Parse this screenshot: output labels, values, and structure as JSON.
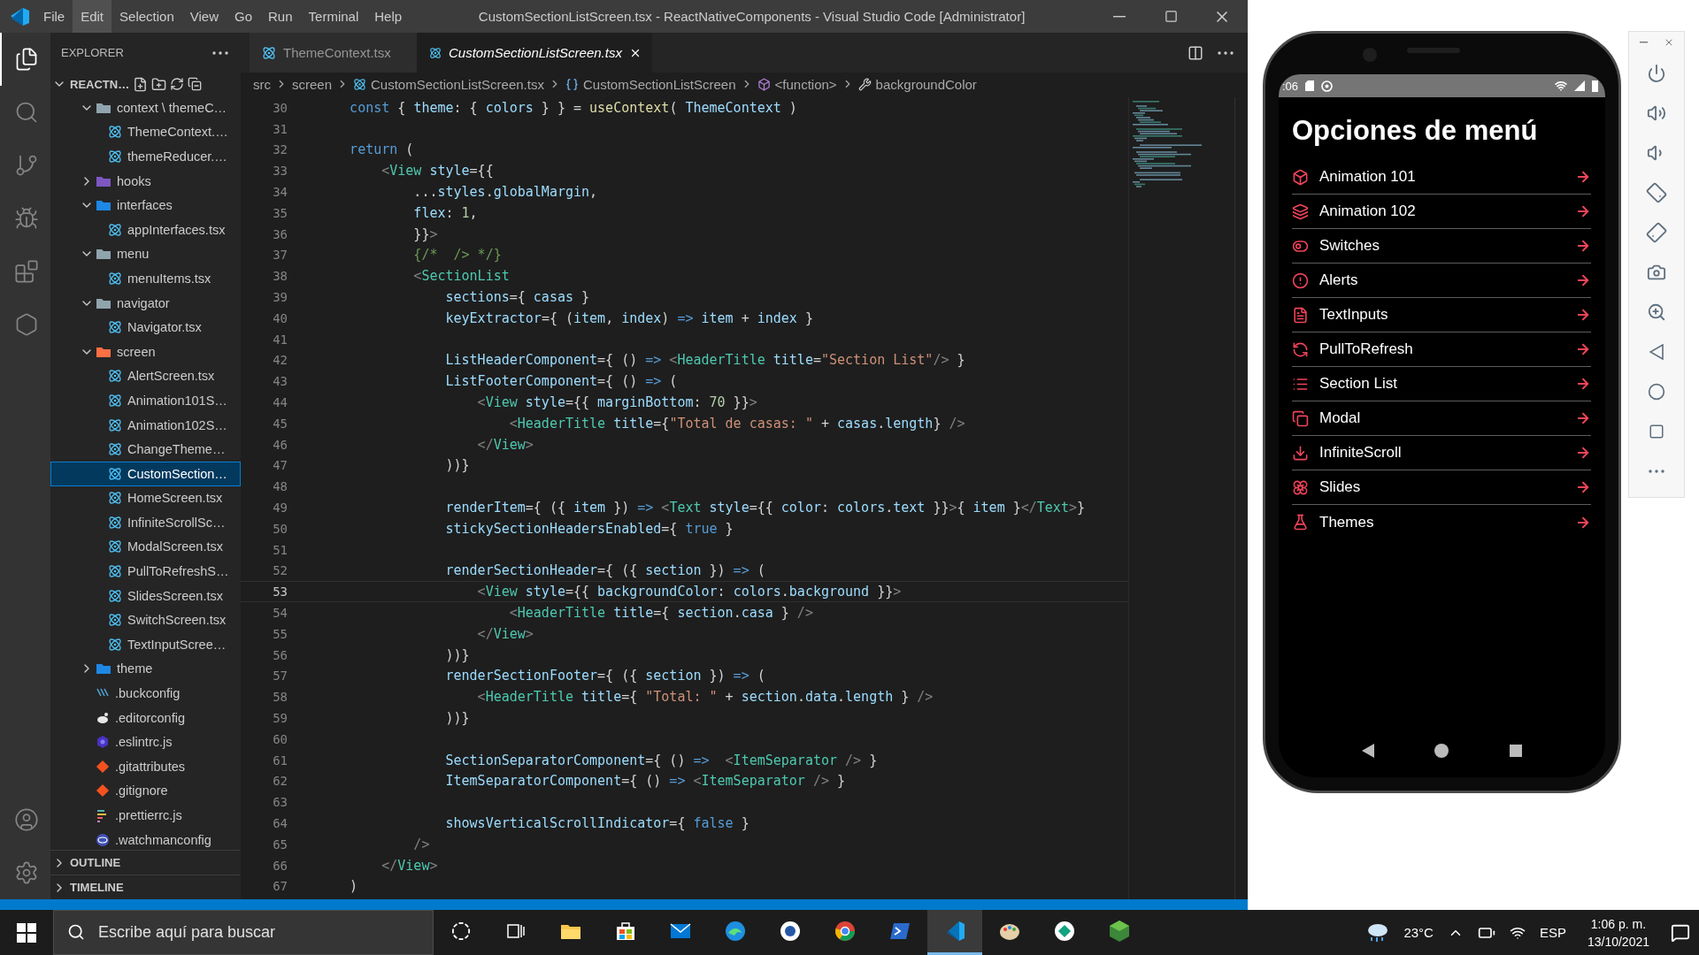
{
  "window": {
    "title": "CustomSectionListScreen.tsx - ReactNativeComponents - Visual Studio Code [Administrator]",
    "menu": [
      {
        "label": "File",
        "selected": false
      },
      {
        "label": "Edit",
        "selected": true
      },
      {
        "label": "Selection",
        "selected": false
      },
      {
        "label": "View",
        "selected": false
      },
      {
        "label": "Go",
        "selected": false
      },
      {
        "label": "Run",
        "selected": false
      },
      {
        "label": "Terminal",
        "selected": false
      },
      {
        "label": "Help",
        "selected": false
      }
    ]
  },
  "activity_bar": [
    {
      "selected": true
    },
    {
      "selected": false
    },
    {
      "selected": false
    },
    {
      "selected": false
    },
    {
      "selected": false
    },
    {
      "selected": false
    }
  ],
  "explorer": {
    "title": "EXPLORER",
    "root": {
      "label": "REACTN…",
      "expanded": true
    },
    "items": [
      {
        "label": "context \\ themeC…",
        "kind": "folder",
        "color": "#90a4ae",
        "expanded": true,
        "selected": false,
        "children": [
          {
            "label": "ThemeContext.…",
            "kind": "react",
            "selected": false
          },
          {
            "label": "themeReducer.…",
            "kind": "react",
            "selected": false
          }
        ]
      },
      {
        "label": "hooks",
        "kind": "folder",
        "color": "#7e57c2",
        "expanded": false,
        "selected": false
      },
      {
        "label": "interfaces",
        "kind": "folder",
        "color": "#1e88e5",
        "expanded": true,
        "selected": false,
        "children": [
          {
            "label": "appInterfaces.tsx",
            "kind": "react",
            "selected": false
          }
        ]
      },
      {
        "label": "menu",
        "kind": "folder",
        "color": "#90a4ae",
        "expanded": true,
        "selected": false,
        "children": [
          {
            "label": "menuItems.tsx",
            "kind": "react",
            "selected": false
          }
        ]
      },
      {
        "label": "navigator",
        "kind": "folder",
        "color": "#90a4ae",
        "expanded": true,
        "selected": false,
        "children": [
          {
            "label": "Navigator.tsx",
            "kind": "react",
            "selected": false
          }
        ]
      },
      {
        "label": "screen",
        "kind": "folder",
        "color": "#ff7043",
        "expanded": true,
        "selected": false,
        "children": [
          {
            "label": "AlertScreen.tsx",
            "kind": "react",
            "selected": false
          },
          {
            "label": "Animation101S…",
            "kind": "react",
            "selected": false
          },
          {
            "label": "Animation102S…",
            "kind": "react",
            "selected": false
          },
          {
            "label": "ChangeTheme…",
            "kind": "react",
            "selected": false
          },
          {
            "label": "CustomSection…",
            "kind": "react",
            "selected": true
          },
          {
            "label": "HomeScreen.tsx",
            "kind": "react",
            "selected": false
          },
          {
            "label": "InfiniteScrollSc…",
            "kind": "react",
            "selected": false
          },
          {
            "label": "ModalScreen.tsx",
            "kind": "react",
            "selected": false
          },
          {
            "label": "PullToRefreshS…",
            "kind": "react",
            "selected": false
          },
          {
            "label": "SlidesScreen.tsx",
            "kind": "react",
            "selected": false
          },
          {
            "label": "SwitchScreen.tsx",
            "kind": "react",
            "selected": false
          },
          {
            "label": "TextInputScree…",
            "kind": "react",
            "selected": false
          }
        ]
      },
      {
        "label": "theme",
        "kind": "folder",
        "color": "#1e88e5",
        "expanded": false,
        "selected": false
      },
      {
        "label": ".buckconfig",
        "kind": "buck",
        "selected": false
      },
      {
        "label": ".editorconfig",
        "kind": "editor",
        "selected": false
      },
      {
        "label": ".eslintrc.js",
        "kind": "eslint",
        "selected": false
      },
      {
        "label": ".gitattributes",
        "kind": "git",
        "selected": false
      },
      {
        "label": ".gitignore",
        "kind": "git",
        "selected": false
      },
      {
        "label": ".prettierrc.js",
        "kind": "prettier",
        "selected": false
      },
      {
        "label": ".watchmanconfig",
        "kind": "watchman",
        "selected": false
      }
    ],
    "sections": [
      {
        "label": "OUTLINE",
        "expanded": false
      },
      {
        "label": "TIMELINE",
        "expanded": false
      }
    ]
  },
  "tabs": [
    {
      "label": "ThemeContext.tsx",
      "selected": false
    },
    {
      "label": "CustomSectionListScreen.tsx",
      "selected": true
    }
  ],
  "breadcrumbs": [
    {
      "label": "src",
      "kind": "folder"
    },
    {
      "label": "screen",
      "kind": "folder"
    },
    {
      "label": "CustomSectionListScreen.tsx",
      "kind": "file"
    },
    {
      "label": "CustomSectionListScreen",
      "kind": "component"
    },
    {
      "label": "<function>",
      "kind": "function"
    },
    {
      "label": "backgroundColor",
      "kind": "property"
    }
  ],
  "editor": {
    "lines": [
      {
        "number": "30",
        "current": false,
        "tokens": [
          {
            "kind": "k",
            "text": "    const"
          },
          {
            "kind": "p",
            "text": " { "
          },
          {
            "kind": "v",
            "text": "theme"
          },
          {
            "kind": "p",
            "text": ": { "
          },
          {
            "kind": "v",
            "text": "colors"
          },
          {
            "kind": "p",
            "text": " } } = "
          },
          {
            "kind": "f",
            "text": "useContext"
          },
          {
            "kind": "p",
            "text": "( "
          },
          {
            "kind": "v",
            "text": "ThemeContext"
          },
          {
            "kind": "p",
            "text": " )"
          }
        ]
      },
      {
        "number": "31",
        "current": false
      },
      {
        "number": "32",
        "current": false,
        "tokens": [
          {
            "kind": "k",
            "text": "    return"
          },
          {
            "kind": "p",
            "text": " ("
          }
        ]
      },
      {
        "number": "33",
        "current": false,
        "tokens": [
          {
            "kind": "g",
            "text": "        <"
          },
          {
            "kind": "c",
            "text": "View"
          },
          {
            "kind": "v",
            "text": " style"
          },
          {
            "kind": "p",
            "text": "={{"
          }
        ]
      },
      {
        "number": "34",
        "current": false,
        "tokens": [
          {
            "kind": "p",
            "text": "            ..."
          },
          {
            "kind": "v",
            "text": "styles"
          },
          {
            "kind": "p",
            "text": "."
          },
          {
            "kind": "v",
            "text": "globalMargin"
          },
          {
            "kind": "p",
            "text": ","
          }
        ]
      },
      {
        "number": "35",
        "current": false,
        "tokens": [
          {
            "kind": "v",
            "text": "            flex"
          },
          {
            "kind": "p",
            "text": ": "
          },
          {
            "kind": "n",
            "text": "1"
          },
          {
            "kind": "p",
            "text": ","
          }
        ]
      },
      {
        "number": "36",
        "current": false,
        "tokens": [
          {
            "kind": "p",
            "text": "            }}"
          },
          {
            "kind": "g",
            "text": ">"
          }
        ]
      },
      {
        "number": "37",
        "current": false,
        "tokens": [
          {
            "kind": "m",
            "text": "            {/*  /> */}"
          }
        ]
      },
      {
        "number": "38",
        "current": false,
        "tokens": [
          {
            "kind": "g",
            "text": "            <"
          },
          {
            "kind": "c",
            "text": "SectionList"
          }
        ]
      },
      {
        "number": "39",
        "current": false,
        "tokens": [
          {
            "kind": "v",
            "text": "                sections"
          },
          {
            "kind": "p",
            "text": "={ "
          },
          {
            "kind": "v",
            "text": "casas"
          },
          {
            "kind": "p",
            "text": " }"
          }
        ]
      },
      {
        "number": "40",
        "current": false,
        "tokens": [
          {
            "kind": "v",
            "text": "                keyExtractor"
          },
          {
            "kind": "p",
            "text": "={ ("
          },
          {
            "kind": "v",
            "text": "item"
          },
          {
            "kind": "p",
            "text": ", "
          },
          {
            "kind": "v",
            "text": "index"
          },
          {
            "kind": "p",
            "text": ") "
          },
          {
            "kind": "k",
            "text": "=>"
          },
          {
            "kind": "v",
            "text": " item"
          },
          {
            "kind": "p",
            "text": " + "
          },
          {
            "kind": "v",
            "text": "index"
          },
          {
            "kind": "p",
            "text": " }"
          }
        ]
      },
      {
        "number": "41",
        "current": false
      },
      {
        "number": "42",
        "current": false,
        "tokens": [
          {
            "kind": "v",
            "text": "                ListHeaderComponent"
          },
          {
            "kind": "p",
            "text": "={ () "
          },
          {
            "kind": "k",
            "text": "=>"
          },
          {
            "kind": "g",
            "text": " <"
          },
          {
            "kind": "c",
            "text": "HeaderTitle"
          },
          {
            "kind": "v",
            "text": " title"
          },
          {
            "kind": "p",
            "text": "="
          },
          {
            "kind": "s",
            "text": "\"Section List\""
          },
          {
            "kind": "g",
            "text": "/>"
          },
          {
            "kind": "p",
            "text": " }"
          }
        ]
      },
      {
        "number": "43",
        "current": false,
        "tokens": [
          {
            "kind": "v",
            "text": "                ListFooterComponent"
          },
          {
            "kind": "p",
            "text": "={ () "
          },
          {
            "kind": "k",
            "text": "=>"
          },
          {
            "kind": "p",
            "text": " ("
          }
        ]
      },
      {
        "number": "44",
        "current": false,
        "tokens": [
          {
            "kind": "g",
            "text": "                    <"
          },
          {
            "kind": "c",
            "text": "View"
          },
          {
            "kind": "v",
            "text": " style"
          },
          {
            "kind": "p",
            "text": "={{ "
          },
          {
            "kind": "v",
            "text": "marginBottom"
          },
          {
            "kind": "p",
            "text": ": "
          },
          {
            "kind": "n",
            "text": "70"
          },
          {
            "kind": "p",
            "text": " }}"
          },
          {
            "kind": "g",
            "text": ">"
          }
        ]
      },
      {
        "number": "45",
        "current": false,
        "tokens": [
          {
            "kind": "g",
            "text": "                        <"
          },
          {
            "kind": "c",
            "text": "HeaderTitle"
          },
          {
            "kind": "v",
            "text": " title"
          },
          {
            "kind": "p",
            "text": "={"
          },
          {
            "kind": "s",
            "text": "\"Total de casas: \""
          },
          {
            "kind": "p",
            "text": " + "
          },
          {
            "kind": "v",
            "text": "casas"
          },
          {
            "kind": "p",
            "text": "."
          },
          {
            "kind": "v",
            "text": "length"
          },
          {
            "kind": "p",
            "text": "}"
          },
          {
            "kind": "g",
            "text": " />"
          }
        ]
      },
      {
        "number": "46",
        "current": false,
        "tokens": [
          {
            "kind": "g",
            "text": "                    </"
          },
          {
            "kind": "c",
            "text": "View"
          },
          {
            "kind": "g",
            "text": ">"
          }
        ]
      },
      {
        "number": "47",
        "current": false,
        "tokens": [
          {
            "kind": "p",
            "text": "                ))}"
          }
        ]
      },
      {
        "number": "48",
        "current": false
      },
      {
        "number": "49",
        "current": false,
        "tokens": [
          {
            "kind": "v",
            "text": "                renderItem"
          },
          {
            "kind": "p",
            "text": "={ ({ "
          },
          {
            "kind": "v",
            "text": "item"
          },
          {
            "kind": "p",
            "text": " }) "
          },
          {
            "kind": "k",
            "text": "=>"
          },
          {
            "kind": "g",
            "text": " <"
          },
          {
            "kind": "c",
            "text": "Text"
          },
          {
            "kind": "v",
            "text": " style"
          },
          {
            "kind": "p",
            "text": "={{ "
          },
          {
            "kind": "v",
            "text": "color"
          },
          {
            "kind": "p",
            "text": ": "
          },
          {
            "kind": "v",
            "text": "colors"
          },
          {
            "kind": "p",
            "text": "."
          },
          {
            "kind": "v",
            "text": "text"
          },
          {
            "kind": "p",
            "text": " }}"
          },
          {
            "kind": "g",
            "text": ">"
          },
          {
            "kind": "p",
            "text": "{ "
          },
          {
            "kind": "v",
            "text": "item"
          },
          {
            "kind": "p",
            "text": " }"
          },
          {
            "kind": "g",
            "text": "</"
          },
          {
            "kind": "c",
            "text": "Text"
          },
          {
            "kind": "g",
            "text": ">"
          },
          {
            "kind": "p",
            "text": "}"
          }
        ]
      },
      {
        "number": "50",
        "current": false,
        "tokens": [
          {
            "kind": "v",
            "text": "                stickySectionHeadersEnabled"
          },
          {
            "kind": "p",
            "text": "={ "
          },
          {
            "kind": "k",
            "text": "true"
          },
          {
            "kind": "p",
            "text": " }"
          }
        ]
      },
      {
        "number": "51",
        "current": false
      },
      {
        "number": "52",
        "current": false,
        "tokens": [
          {
            "kind": "v",
            "text": "                renderSectionHeader"
          },
          {
            "kind": "p",
            "text": "={ ({ "
          },
          {
            "kind": "v",
            "text": "section"
          },
          {
            "kind": "p",
            "text": " }) "
          },
          {
            "kind": "k",
            "text": "=>"
          },
          {
            "kind": "p",
            "text": " ("
          }
        ]
      },
      {
        "number": "53",
        "current": true,
        "tokens": [
          {
            "kind": "g",
            "text": "                    <"
          },
          {
            "kind": "c",
            "text": "View"
          },
          {
            "kind": "v",
            "text": " style"
          },
          {
            "kind": "p",
            "text": "={{ "
          },
          {
            "kind": "v",
            "text": "backgroundColor"
          },
          {
            "kind": "p",
            "text": ": "
          },
          {
            "kind": "v",
            "text": "colors"
          },
          {
            "kind": "p",
            "text": "."
          },
          {
            "kind": "v",
            "text": "background"
          },
          {
            "kind": "p",
            "text": " }}"
          },
          {
            "kind": "g",
            "text": ">"
          }
        ]
      },
      {
        "number": "54",
        "current": false,
        "tokens": [
          {
            "kind": "g",
            "text": "                        <"
          },
          {
            "kind": "c",
            "text": "HeaderTitle"
          },
          {
            "kind": "v",
            "text": " title"
          },
          {
            "kind": "p",
            "text": "={ "
          },
          {
            "kind": "v",
            "text": "section"
          },
          {
            "kind": "p",
            "text": "."
          },
          {
            "kind": "v",
            "text": "casa"
          },
          {
            "kind": "p",
            "text": " }"
          },
          {
            "kind": "g",
            "text": " />"
          }
        ]
      },
      {
        "number": "55",
        "current": false,
        "tokens": [
          {
            "kind": "g",
            "text": "                    </"
          },
          {
            "kind": "c",
            "text": "View"
          },
          {
            "kind": "g",
            "text": ">"
          }
        ]
      },
      {
        "number": "56",
        "current": false,
        "tokens": [
          {
            "kind": "p",
            "text": "                ))}"
          }
        ]
      },
      {
        "number": "57",
        "current": false,
        "tokens": [
          {
            "kind": "v",
            "text": "                renderSectionFooter"
          },
          {
            "kind": "p",
            "text": "={ ({ "
          },
          {
            "kind": "v",
            "text": "section"
          },
          {
            "kind": "p",
            "text": " }) "
          },
          {
            "kind": "k",
            "text": "=>"
          },
          {
            "kind": "p",
            "text": " ("
          }
        ]
      },
      {
        "number": "58",
        "current": false,
        "tokens": [
          {
            "kind": "g",
            "text": "                    <"
          },
          {
            "kind": "c",
            "text": "HeaderTitle"
          },
          {
            "kind": "v",
            "text": " title"
          },
          {
            "kind": "p",
            "text": "={ "
          },
          {
            "kind": "s",
            "text": "\"Total: \""
          },
          {
            "kind": "p",
            "text": " + "
          },
          {
            "kind": "v",
            "text": "section"
          },
          {
            "kind": "p",
            "text": "."
          },
          {
            "kind": "v",
            "text": "data"
          },
          {
            "kind": "p",
            "text": "."
          },
          {
            "kind": "v",
            "text": "length"
          },
          {
            "kind": "p",
            "text": " }"
          },
          {
            "kind": "g",
            "text": " />"
          }
        ]
      },
      {
        "number": "59",
        "current": false,
        "tokens": [
          {
            "kind": "p",
            "text": "                ))}"
          }
        ]
      },
      {
        "number": "60",
        "current": false
      },
      {
        "number": "61",
        "current": false,
        "tokens": [
          {
            "kind": "v",
            "text": "                SectionSeparatorComponent"
          },
          {
            "kind": "p",
            "text": "={ () "
          },
          {
            "kind": "k",
            "text": "=>"
          },
          {
            "kind": "g",
            "text": "  <"
          },
          {
            "kind": "c",
            "text": "ItemSeparator"
          },
          {
            "kind": "g",
            "text": " />"
          },
          {
            "kind": "p",
            "text": " }"
          }
        ]
      },
      {
        "number": "62",
        "current": false,
        "tokens": [
          {
            "kind": "v",
            "text": "                ItemSeparatorComponent"
          },
          {
            "kind": "p",
            "text": "={ () "
          },
          {
            "kind": "k",
            "text": "=>"
          },
          {
            "kind": "g",
            "text": " <"
          },
          {
            "kind": "c",
            "text": "ItemSeparator"
          },
          {
            "kind": "g",
            "text": " />"
          },
          {
            "kind": "p",
            "text": " }"
          }
        ]
      },
      {
        "number": "63",
        "current": false
      },
      {
        "number": "64",
        "current": false,
        "tokens": [
          {
            "kind": "v",
            "text": "                showsVerticalScrollIndicator"
          },
          {
            "kind": "p",
            "text": "={ "
          },
          {
            "kind": "k",
            "text": "false"
          },
          {
            "kind": "p",
            "text": " }"
          }
        ]
      },
      {
        "number": "65",
        "current": false,
        "tokens": [
          {
            "kind": "g",
            "text": "            />"
          }
        ]
      },
      {
        "number": "66",
        "current": false,
        "tokens": [
          {
            "kind": "g",
            "text": "        </"
          },
          {
            "kind": "c",
            "text": "View"
          },
          {
            "kind": "g",
            "text": ">"
          }
        ]
      },
      {
        "number": "67",
        "current": false,
        "tokens": [
          {
            "kind": "p",
            "text": "    )"
          }
        ]
      }
    ]
  },
  "phone": {
    "status_time": ":06",
    "title": "Opciones de menú",
    "menu_items": [
      {
        "label": "Animation 101"
      },
      {
        "label": "Animation 102"
      },
      {
        "label": "Switches"
      },
      {
        "label": "Alerts"
      },
      {
        "label": "TextInputs"
      },
      {
        "label": "PullToRefresh"
      },
      {
        "label": "Section List"
      },
      {
        "label": "Modal"
      },
      {
        "label": "InfiniteScroll"
      },
      {
        "label": "Slides"
      },
      {
        "label": "Themes"
      }
    ]
  },
  "taskbar": {
    "search": {
      "placeholder": "Escribe aquí para buscar"
    },
    "apps": [
      {
        "active": false
      },
      {
        "active": false
      },
      {
        "active": false
      },
      {
        "active": false
      },
      {
        "active": false
      },
      {
        "active": false
      },
      {
        "active": false
      },
      {
        "active": false
      },
      {
        "active": false
      },
      {
        "active": true
      },
      {
        "active": false
      },
      {
        "active": false
      },
      {
        "active": false
      }
    ],
    "temperature": "23°C",
    "language": "ESP",
    "time": "1:06 p. m.",
    "date": "13/10/2021"
  }
}
